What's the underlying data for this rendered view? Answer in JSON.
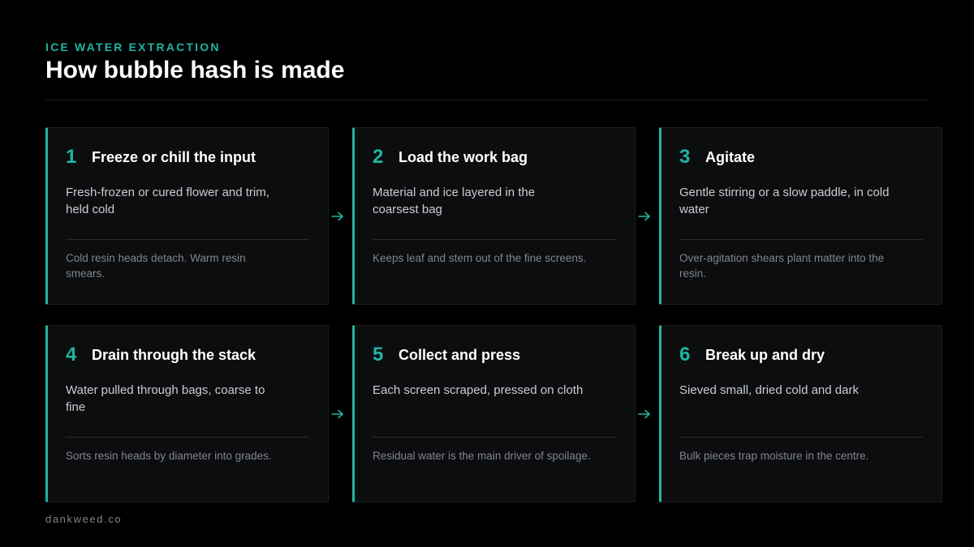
{
  "header": {
    "eyebrow": "ICE WATER EXTRACTION",
    "title": "How bubble hash is made"
  },
  "colors": {
    "accent": "#1fb5a3",
    "background": "#000000",
    "card": "#0c0d0f"
  },
  "steps": [
    {
      "number": "1",
      "title": "Freeze or chill the input",
      "description": "Fresh-frozen or cured flower and trim, held cold",
      "note": "Cold resin heads detach. Warm resin smears."
    },
    {
      "number": "2",
      "title": "Load the work bag",
      "description": "Material and ice layered in the coarsest bag",
      "note": "Keeps leaf and stem out of the fine screens."
    },
    {
      "number": "3",
      "title": "Agitate",
      "description": "Gentle stirring or a slow paddle, in cold water",
      "note": "Over-agitation shears plant matter into the resin."
    },
    {
      "number": "4",
      "title": "Drain through the stack",
      "description": "Water pulled through bags, coarse to fine",
      "note": "Sorts resin heads by diameter into grades."
    },
    {
      "number": "5",
      "title": "Collect and press",
      "description": "Each screen scraped, pressed on cloth",
      "note": "Residual water is the main driver of spoilage."
    },
    {
      "number": "6",
      "title": "Break up and dry",
      "description": "Sieved small, dried cold and dark",
      "note": "Bulk pieces trap moisture in the centre."
    }
  ],
  "connector_icon": "arrow-right-icon",
  "footer": {
    "brand": "dankweed.co"
  }
}
